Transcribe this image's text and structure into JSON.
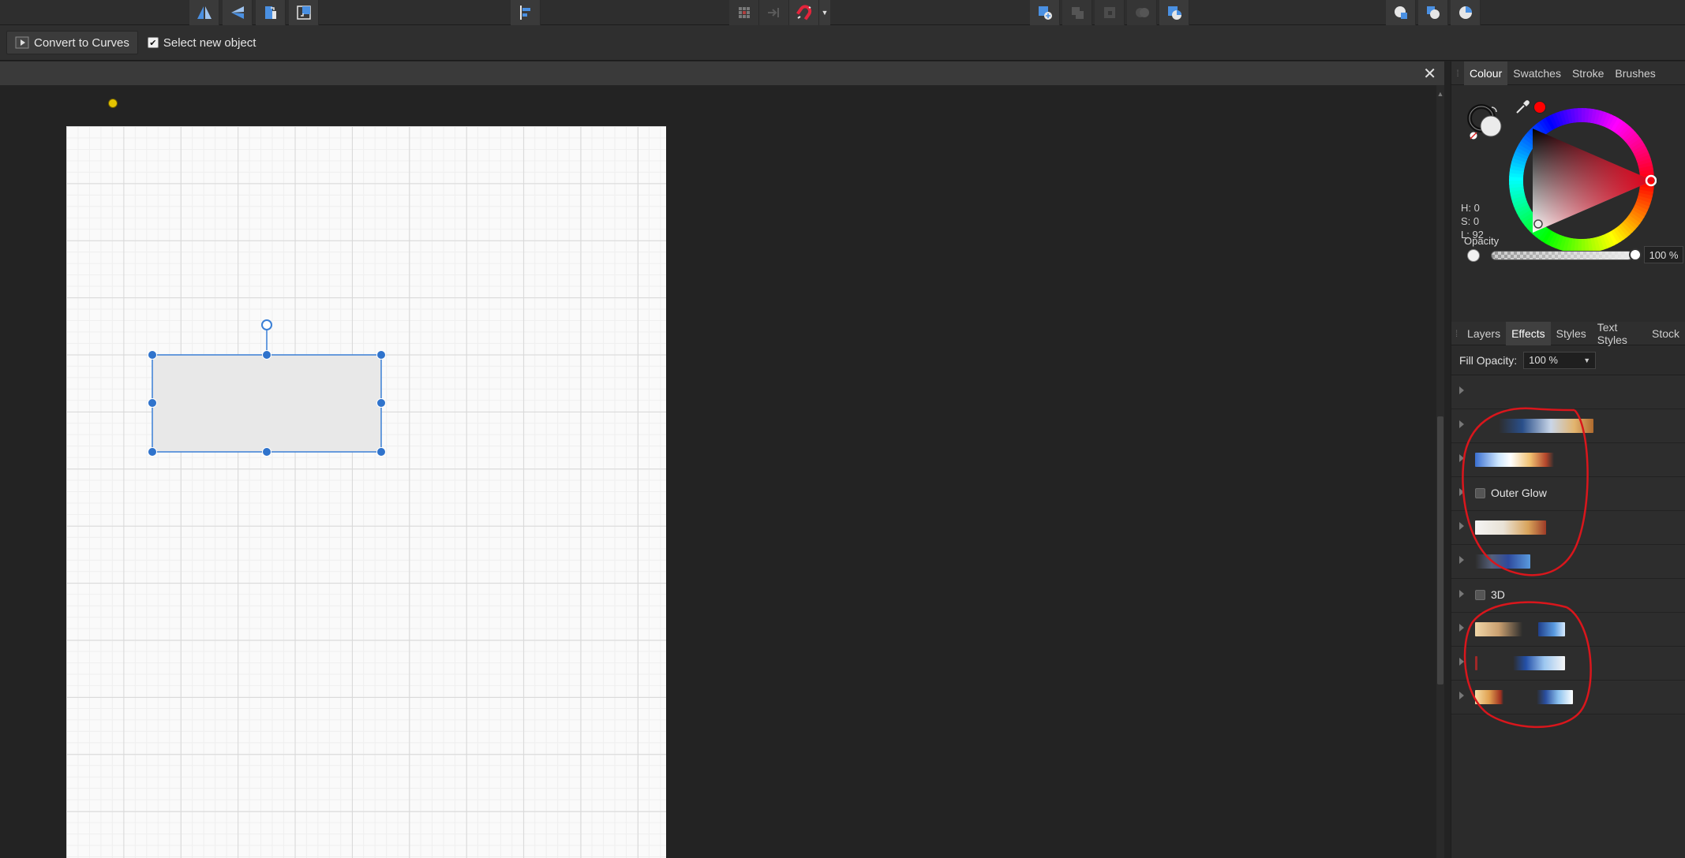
{
  "context_toolbar": {
    "convert_label": "Convert to Curves",
    "select_new_label": "Select new object",
    "select_new_checked": true
  },
  "document": {
    "close_glyph": "✕"
  },
  "toolbar": {
    "icons": [
      "flip-horizontal-icon",
      "flip-vertical-icon",
      "rotate-left-icon",
      "rotate-right-icon",
      "align-left-icon",
      "snapping-grid-icon",
      "snapping-options-icon",
      "magnet-icon",
      "insert-behind-icon",
      "boolean-add-icon",
      "boolean-subtract-icon",
      "boolean-intersect-icon",
      "boolean-xor-icon",
      "boolean-divide-icon",
      "arrange-front-icon",
      "arrange-back-icon",
      "arrange-forward-icon"
    ],
    "magnet_color": "#e3243b",
    "accent_color": "#4a90e2"
  },
  "colour_panel": {
    "tabs": [
      "Colour",
      "Swatches",
      "Stroke",
      "Brushes"
    ],
    "active_tab": "Colour",
    "h": "H: 0",
    "s": "S: 0",
    "l": "L: 92",
    "opacity_label": "Opacity",
    "opacity_value": "100 %",
    "current_color": "#ff0000"
  },
  "effects_panel": {
    "tabs": [
      "Layers",
      "Effects",
      "Styles",
      "Text Styles",
      "Stock"
    ],
    "active_tab": "Effects",
    "fill_opacity_label": "Fill Opacity:",
    "fill_opacity_value": "100 %",
    "rows": [
      {
        "label": ""
      },
      {
        "label": ""
      },
      {
        "label": ""
      },
      {
        "label": "Outer Glow"
      },
      {
        "label": ""
      },
      {
        "label": ""
      },
      {
        "label": "3D"
      },
      {
        "label": ""
      },
      {
        "label": ""
      },
      {
        "label": ""
      }
    ]
  }
}
